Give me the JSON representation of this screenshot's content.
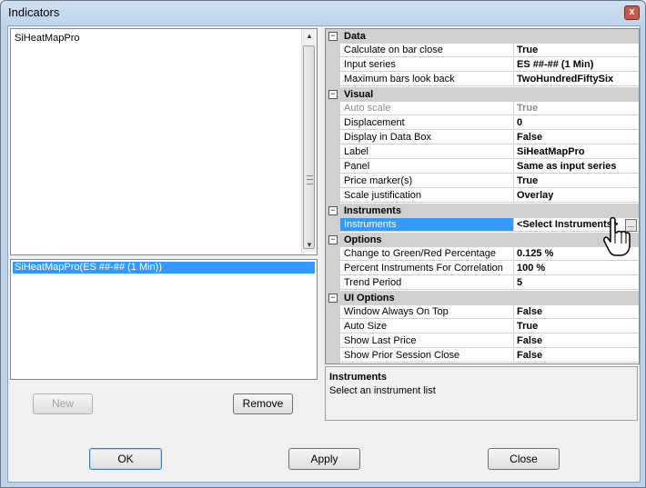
{
  "window": {
    "title": "Indicators",
    "close_glyph": "x"
  },
  "available_list": {
    "items": [
      "SiHeatMapPro"
    ]
  },
  "applied_list": {
    "items": [
      "SiHeatMapPro(ES ##-## (1 Min))"
    ]
  },
  "buttons": {
    "new": "New",
    "remove": "Remove",
    "ok": "OK",
    "apply": "Apply",
    "close": "Close"
  },
  "properties": {
    "data": {
      "label": "Data",
      "rows": [
        {
          "name": "Calculate on bar close",
          "value": "True"
        },
        {
          "name": "Input series",
          "value": "ES ##-## (1 Min)"
        },
        {
          "name": "Maximum bars look back",
          "value": "TwoHundredFiftySix"
        }
      ]
    },
    "visual": {
      "label": "Visual",
      "rows": [
        {
          "name": "Auto scale",
          "value": "True"
        },
        {
          "name": "Displacement",
          "value": "0"
        },
        {
          "name": "Display in Data Box",
          "value": "False"
        },
        {
          "name": "Label",
          "value": "SiHeatMapPro"
        },
        {
          "name": "Panel",
          "value": "Same as input series"
        },
        {
          "name": "Price marker(s)",
          "value": "True"
        },
        {
          "name": "Scale justification",
          "value": "Overlay"
        }
      ]
    },
    "instruments": {
      "label": "Instruments",
      "rows": [
        {
          "name": "Instruments",
          "value": "<Select Instruments>",
          "ellipsis": "..."
        }
      ]
    },
    "options": {
      "label": "Options",
      "rows": [
        {
          "name": "Change to Green/Red Percentage",
          "value": "0.125 %"
        },
        {
          "name": "Percent Instruments For Correlation",
          "value": "100 %"
        },
        {
          "name": "Trend Period",
          "value": "5"
        }
      ]
    },
    "ui_options": {
      "label": "UI Options",
      "rows": [
        {
          "name": "Window Always On Top",
          "value": "False"
        },
        {
          "name": "Auto Size",
          "value": "True"
        },
        {
          "name": "Show Last Price",
          "value": "False"
        },
        {
          "name": "Show Prior Session Close",
          "value": "False"
        }
      ]
    }
  },
  "help": {
    "title": "Instruments",
    "description": "Select an instrument list"
  },
  "icons": {
    "collapse": "minus-box-icon",
    "cursor": "hand-pointer-icon"
  }
}
